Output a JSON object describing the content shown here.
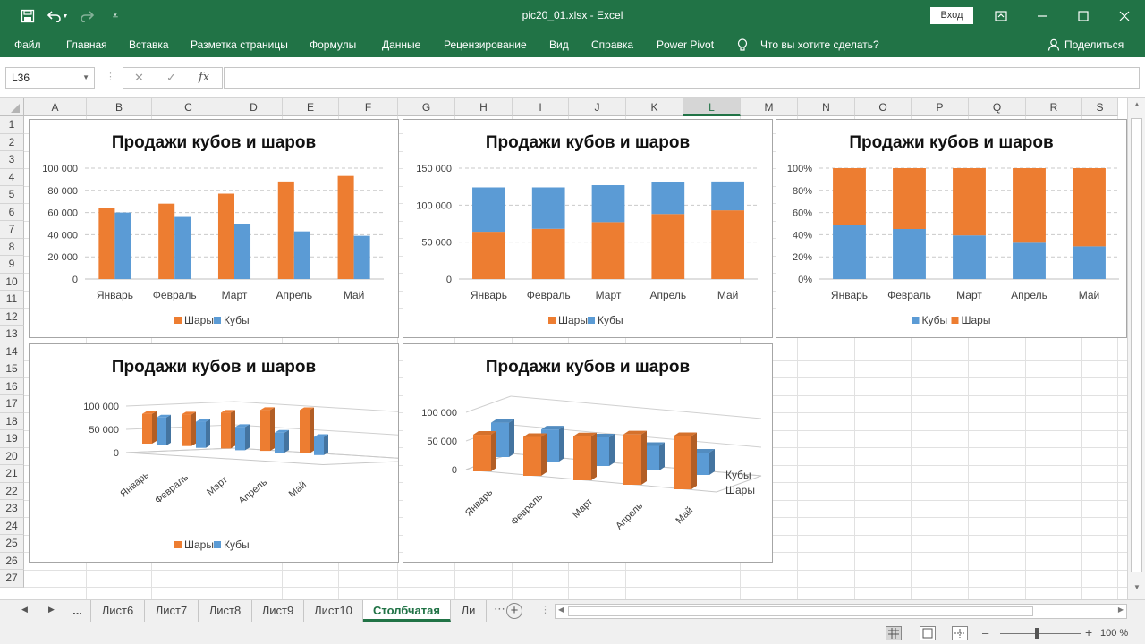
{
  "window": {
    "title": "pic20_01.xlsx  -  Excel",
    "signin_label": "Вход"
  },
  "ribbon": {
    "tabs": [
      "Файл",
      "Главная",
      "Вставка",
      "Разметка страницы",
      "Формулы",
      "Данные",
      "Рецензирование",
      "Вид",
      "Справка",
      "Power Pivot"
    ],
    "tell_me": "Что вы хотите сделать?",
    "share": "Поделиться"
  },
  "formula_bar": {
    "name_box": "L36",
    "fx": "fx",
    "formula": ""
  },
  "grid": {
    "columns": [
      "A",
      "B",
      "C",
      "D",
      "E",
      "F",
      "G",
      "H",
      "I",
      "J",
      "K",
      "L",
      "M",
      "N",
      "O",
      "P",
      "Q",
      "R",
      "S"
    ],
    "selected_column": "L",
    "rows": [
      "1",
      "2",
      "3",
      "4",
      "5",
      "6",
      "7",
      "8",
      "9",
      "10",
      "11",
      "12",
      "13",
      "14",
      "15",
      "16",
      "17",
      "18",
      "19",
      "20",
      "21",
      "22",
      "23",
      "24",
      "25",
      "26",
      "27"
    ]
  },
  "chart_data": [
    {
      "type": "bar",
      "title": "Продажи кубов и шаров",
      "categories": [
        "Январь",
        "Февраль",
        "Март",
        "Апрель",
        "Май"
      ],
      "series": [
        {
          "name": "Шары",
          "values": [
            64000,
            68000,
            77000,
            88000,
            93000
          ],
          "color": "#ED7D31"
        },
        {
          "name": "Кубы",
          "values": [
            60000,
            56000,
            50000,
            43000,
            39000
          ],
          "color": "#5B9BD5"
        }
      ],
      "ylim": [
        0,
        100000
      ],
      "yticks": [
        "0",
        "20 000",
        "40 000",
        "60 000",
        "80 000",
        "100 000"
      ],
      "grid": true,
      "legend": "bottom"
    },
    {
      "type": "bar",
      "stacked": true,
      "title": "Продажи кубов и шаров",
      "categories": [
        "Январь",
        "Февраль",
        "Март",
        "Апрель",
        "Май"
      ],
      "series": [
        {
          "name": "Шары",
          "values": [
            64000,
            68000,
            77000,
            88000,
            93000
          ],
          "color": "#ED7D31"
        },
        {
          "name": "Кубы",
          "values": [
            60000,
            56000,
            50000,
            43000,
            39000
          ],
          "color": "#5B9BD5"
        }
      ],
      "ylim": [
        0,
        150000
      ],
      "yticks": [
        "0",
        "50 000",
        "100 000",
        "150 000"
      ],
      "grid": true,
      "legend": "bottom"
    },
    {
      "type": "bar",
      "stacked": "percent",
      "title": "Продажи кубов и шаров",
      "categories": [
        "Январь",
        "Февраль",
        "Март",
        "Апрель",
        "Май"
      ],
      "series": [
        {
          "name": "Кубы",
          "values": [
            60000,
            56000,
            50000,
            43000,
            39000
          ],
          "color": "#5B9BD5"
        },
        {
          "name": "Шары",
          "values": [
            64000,
            68000,
            77000,
            88000,
            93000
          ],
          "color": "#ED7D31"
        }
      ],
      "ylim": [
        0,
        100
      ],
      "yticks": [
        "0%",
        "20%",
        "40%",
        "60%",
        "80%",
        "100%"
      ],
      "grid": true,
      "legend": "bottom"
    },
    {
      "type": "bar",
      "view": "3d-clustered",
      "title": "Продажи кубов и шаров",
      "categories": [
        "Январь",
        "Февраль",
        "Март",
        "Апрель",
        "Май"
      ],
      "series": [
        {
          "name": "Шары",
          "values": [
            64000,
            68000,
            77000,
            88000,
            93000
          ],
          "color": "#ED7D31"
        },
        {
          "name": "Кубы",
          "values": [
            60000,
            56000,
            50000,
            43000,
            39000
          ],
          "color": "#5B9BD5"
        }
      ],
      "ylim": [
        0,
        100000
      ],
      "yticks": [
        "0",
        "50 000",
        "100 000"
      ],
      "grid": true,
      "legend": "bottom"
    },
    {
      "type": "bar",
      "view": "3d-column",
      "title": "Продажи кубов и шаров",
      "categories": [
        "Январь",
        "Февраль",
        "Март",
        "Апрель",
        "Май"
      ],
      "series": [
        {
          "name": "Шары",
          "values": [
            64000,
            68000,
            77000,
            88000,
            93000
          ],
          "color": "#ED7D31"
        },
        {
          "name": "Кубы",
          "values": [
            60000,
            56000,
            50000,
            43000,
            39000
          ],
          "color": "#5B9BD5"
        }
      ],
      "ylim": [
        0,
        100000
      ],
      "yticks": [
        "0",
        "50 000",
        "100 000"
      ],
      "depth_labels": [
        "Кубы",
        "Шары"
      ],
      "grid": true,
      "legend": "none"
    }
  ],
  "sheets": {
    "tabs": [
      "Лист6",
      "Лист7",
      "Лист8",
      "Лист9",
      "Лист10",
      "Столбчатая",
      "Ли"
    ],
    "active": "Столбчатая",
    "ellipsis": "..."
  },
  "status": {
    "zoom": "100 %",
    "zoom_minus": "–",
    "zoom_plus": "+"
  }
}
